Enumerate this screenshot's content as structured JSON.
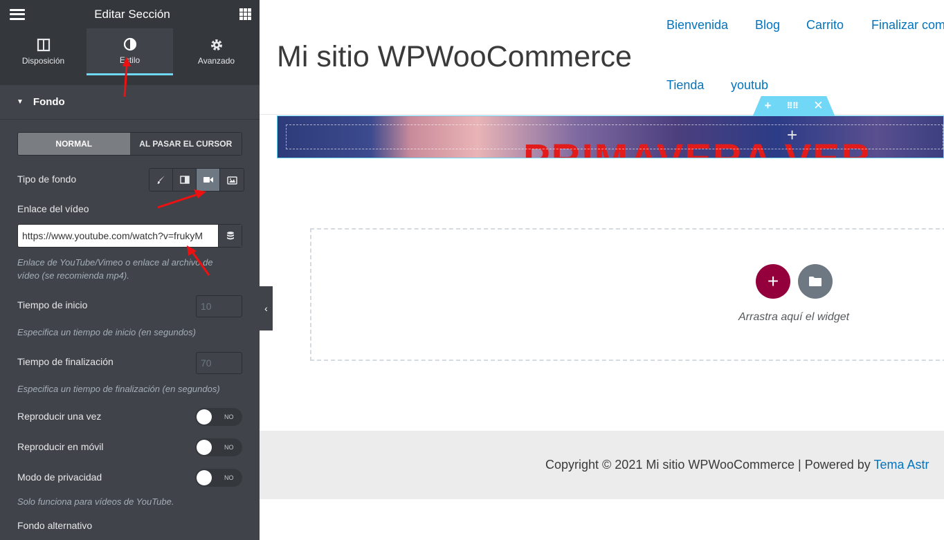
{
  "panel": {
    "title": "Editar Sección",
    "tabs": [
      {
        "label": "Disposición",
        "icon": "layout-icon"
      },
      {
        "label": "Estilo",
        "icon": "half-circle-icon"
      },
      {
        "label": "Avanzado",
        "icon": "gear-icon"
      }
    ],
    "section_title": "Fondo",
    "state_tabs": [
      "NORMAL",
      "AL PASAR EL CURSOR"
    ],
    "background_type_label": "Tipo de fondo",
    "background_type_options": [
      "brush-icon",
      "gradient-icon",
      "video-icon",
      "slideshow-icon"
    ],
    "background_type_selected": "video-icon",
    "video_link_label": "Enlace del vídeo",
    "video_link_value": "https://www.youtube.com/watch?v=frukyM",
    "video_link_help": "Enlace de YouTube/Vimeo o enlace al archivo de vídeo (se recomienda mp4).",
    "start_time_label": "Tiempo de inicio",
    "start_time_placeholder": "10",
    "start_time_help": "Especifica un tiempo de inicio (en segundos)",
    "end_time_label": "Tiempo de finalización",
    "end_time_placeholder": "70",
    "end_time_help": "Especifica un tiempo de finalización (en segundos)",
    "play_once_label": "Reproducir una vez",
    "play_mobile_label": "Reproducir en móvil",
    "privacy_label": "Modo de privacidad",
    "switch_off_text": "NO",
    "privacy_help": "Solo funciona para vídeos de YouTube.",
    "fallback_label": "Fondo alternativo"
  },
  "site": {
    "title": "Mi sitio WPWooCommerce",
    "nav": [
      "Bienvenida",
      "Blog",
      "Carrito",
      "Finalizar com",
      "Tienda",
      "youtub"
    ],
    "banner_text": "PRIMAVERA  VER",
    "drop_text": "Arrastra aquí el widget",
    "add_label": "+",
    "copyright": "Copyright © 2021 Mi sitio WPWooCommerce | Powered by",
    "theme_link": "Tema Astr"
  },
  "colors": {
    "panel_bg": "#404349",
    "panel_header": "#34383c",
    "accent": "#71d7f7",
    "add_button": "#93003c",
    "link": "#0274be",
    "annotation_arrow": "#e11"
  }
}
